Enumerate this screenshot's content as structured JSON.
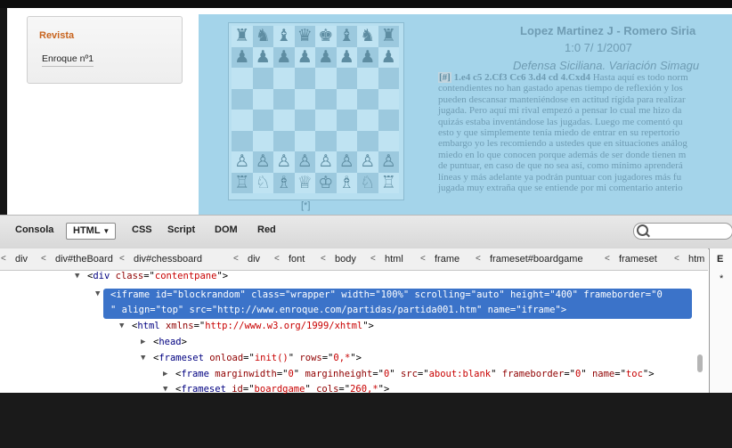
{
  "sidebar": {
    "title": "Revista",
    "link": "Enroque nº1"
  },
  "board": {
    "ranks": [
      [
        "♜",
        "♞",
        "♝",
        "♛",
        "♚",
        "♝",
        "♞",
        "♜"
      ],
      [
        "♟",
        "♟",
        "♟",
        "♟",
        "♟",
        "♟",
        "♟",
        "♟"
      ],
      [
        "",
        "",
        "",
        "",
        "",
        "",
        "",
        ""
      ],
      [
        "",
        "",
        "",
        "",
        "",
        "",
        "",
        ""
      ],
      [
        "",
        "",
        "",
        "",
        "",
        "",
        "",
        ""
      ],
      [
        "",
        "",
        "",
        "",
        "",
        "",
        "",
        ""
      ],
      [
        "♙",
        "♙",
        "♙",
        "♙",
        "♙",
        "♙",
        "♙",
        "♙"
      ],
      [
        "♖",
        "♘",
        "♗",
        "♕",
        "♔",
        "♗",
        "♘",
        "♖"
      ]
    ],
    "caption": "[*]"
  },
  "game": {
    "title": "Lopez Martinez J - Romero Siria",
    "result": "1:0 7/ 1/2007",
    "opening": "Defensa Siciliana. Variación Simagu",
    "tag": "[#]",
    "moves": "1.e4 c5 2.Cf3 Cc6 3.d4 cd 4.Cxd4",
    "lines": [
      " Hasta aquí es todo norm",
      "contendientes no han gastado apenas tiempo de reflexión y los",
      "pueden descansar manteniéndose en actitud rígida para realizar",
      "jugada. Pero aquí mi rival empezó a pensar lo cual me hizo da",
      "quizás estaba inventándose las jugadas. Luego me comentó qu",
      "esto y que simplemente tenía miedo de entrar en su repertorio",
      "embargo yo les recomiendo a ustedes que en situaciones análog",
      "miedo en lo que conocen porque además de ser donde tienen m",
      "de puntuar, en caso de que no sea así, como mínimo aprenderá",
      "líneas y más adelante ya podrán puntuar con jugadores más fu",
      "jugada muy extraña que se entiende por mi comentario anterio"
    ]
  },
  "devtools": {
    "tabs": [
      "Consola",
      "HTML",
      "CSS",
      "Script",
      "DOM",
      "Red"
    ],
    "active_tab_arrow": "▼",
    "breadcrumbs": [
      "div",
      "div#theBoard",
      "div#chessboard",
      "div",
      "font",
      "body",
      "html",
      "frame",
      "frameset#boardgame",
      "frameset",
      "htm"
    ],
    "breadcrumb_separator": "<",
    "right_tab": "E",
    "right_star": "*",
    "code": {
      "l1": {
        "tag": "div",
        "attr": "class",
        "val": "contentpane"
      },
      "l2": {
        "tag": "iframe",
        "attrs": [
          [
            "id",
            "blockrandom"
          ],
          [
            "class",
            "wrapper"
          ],
          [
            "width",
            "100%"
          ],
          [
            "scrolling",
            "auto"
          ],
          [
            "height",
            "400"
          ],
          [
            "frameborder",
            "0"
          ]
        ],
        "attrs2": [
          [
            "align",
            "top"
          ],
          [
            "src",
            "http://www.enroque.com/partidas/partida001.htm"
          ],
          [
            "name",
            "iframe"
          ]
        ]
      },
      "l3": {
        "tag": "html",
        "attr": "xmlns",
        "val": "http://www.w3.org/1999/xhtml"
      },
      "l4": {
        "tag": "head"
      },
      "l5": {
        "tag": "frameset",
        "attrs": [
          [
            "onload",
            "init()"
          ],
          [
            "rows",
            "0,*"
          ]
        ]
      },
      "l6": {
        "tag": "frame",
        "attrs": [
          [
            "marginwidth",
            "0"
          ],
          [
            "marginheight",
            "0"
          ],
          [
            "src",
            "about:blank"
          ],
          [
            "frameborder",
            "0"
          ],
          [
            "name",
            "toc"
          ]
        ]
      },
      "l7": {
        "tag": "frameset",
        "attrs": [
          [
            "id",
            "boardgame"
          ],
          [
            "cols",
            "260,*"
          ]
        ]
      }
    }
  }
}
